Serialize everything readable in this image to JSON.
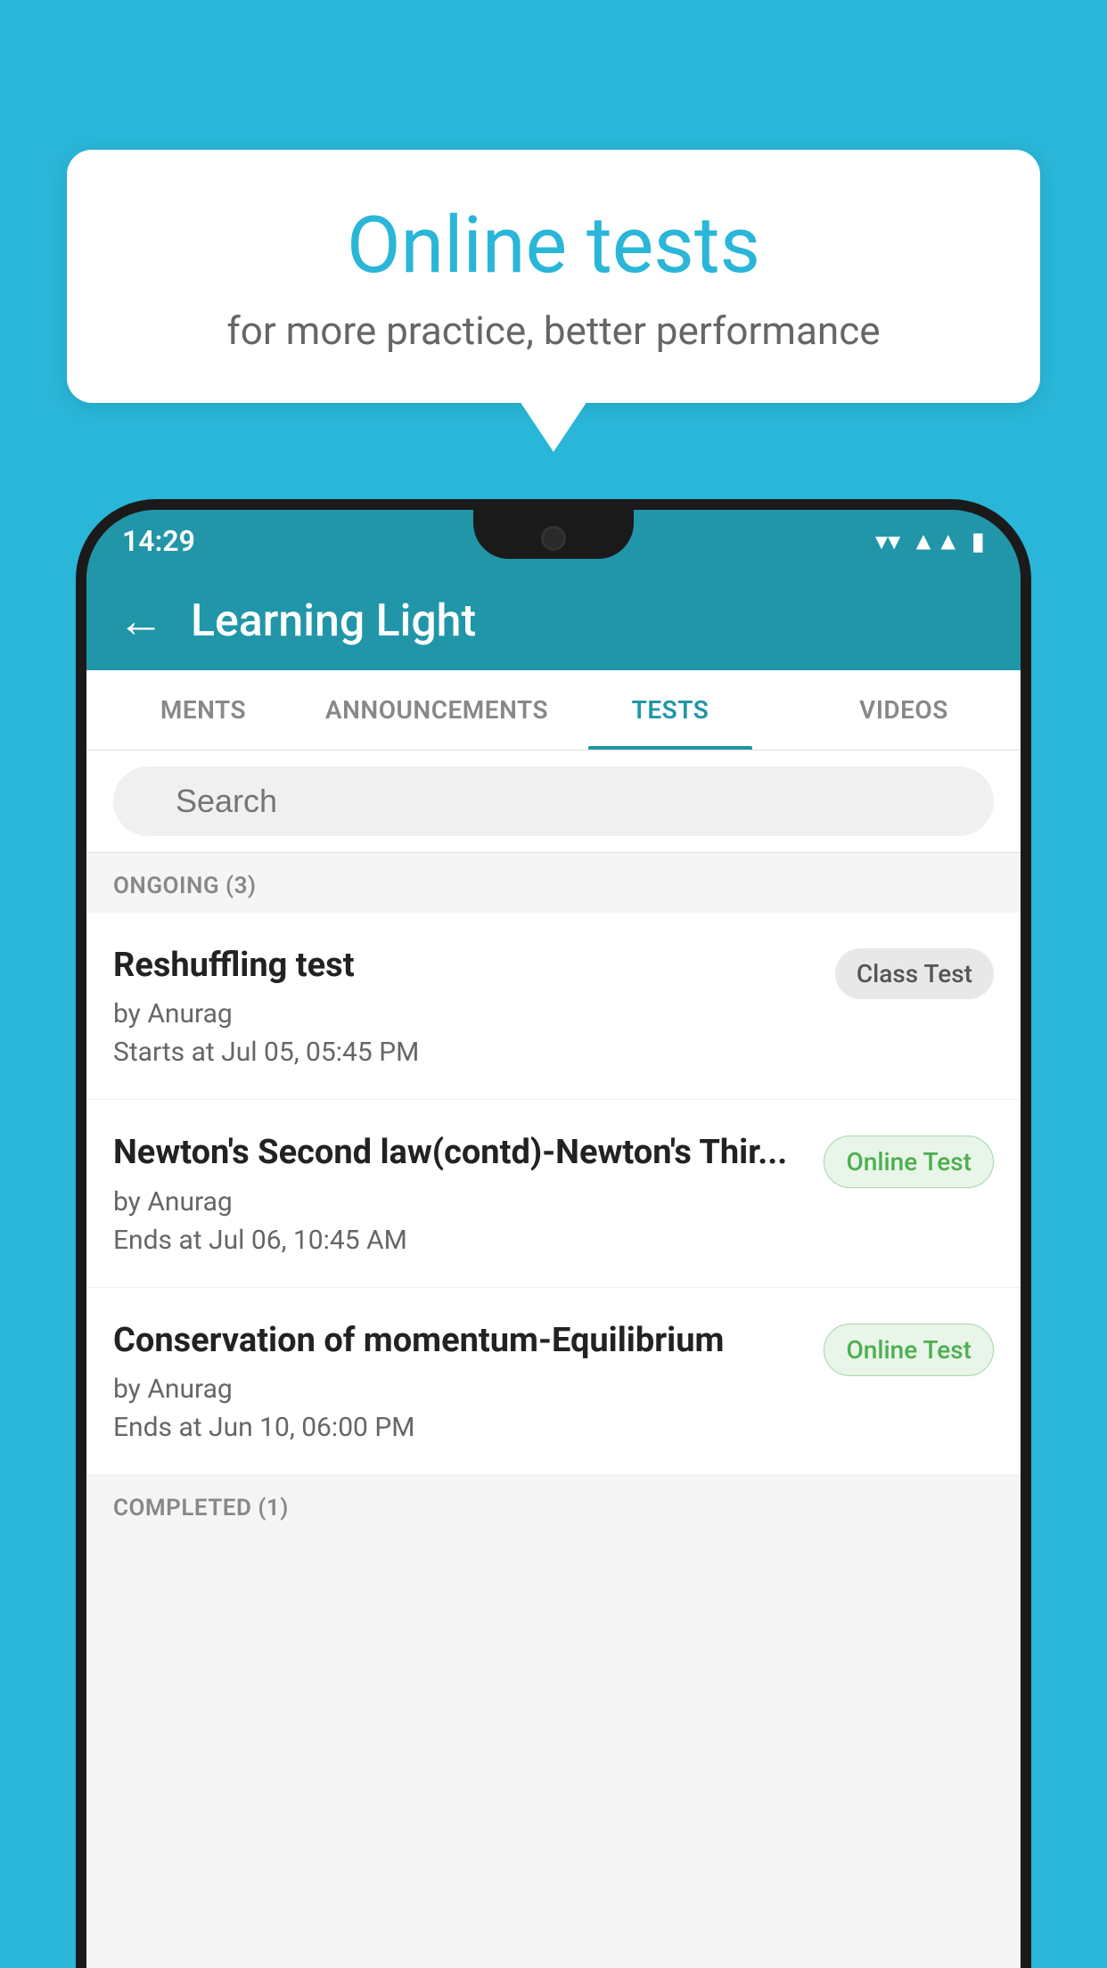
{
  "background_color": "#29b6d8",
  "speech_bubble": {
    "title": "Online tests",
    "subtitle": "for more practice, better performance"
  },
  "status_bar": {
    "time": "14:29",
    "icons": [
      "wifi",
      "signal",
      "battery"
    ]
  },
  "app_header": {
    "title": "Learning Light",
    "back_label": "←"
  },
  "tabs": [
    {
      "label": "MENTS",
      "active": false
    },
    {
      "label": "ANNOUNCEMENTS",
      "active": false
    },
    {
      "label": "TESTS",
      "active": true
    },
    {
      "label": "VIDEOS",
      "active": false
    }
  ],
  "search": {
    "placeholder": "Search"
  },
  "sections": [
    {
      "title": "ONGOING (3)",
      "items": [
        {
          "name": "Reshuffling test",
          "by": "by Anurag",
          "time": "Starts at  Jul 05, 05:45 PM",
          "badge": "Class Test",
          "badge_type": "class"
        },
        {
          "name": "Newton's Second law(contd)-Newton's Thir...",
          "by": "by Anurag",
          "time": "Ends at  Jul 06, 10:45 AM",
          "badge": "Online Test",
          "badge_type": "online"
        },
        {
          "name": "Conservation of momentum-Equilibrium",
          "by": "by Anurag",
          "time": "Ends at  Jun 10, 06:00 PM",
          "badge": "Online Test",
          "badge_type": "online"
        }
      ]
    },
    {
      "title": "COMPLETED (1)",
      "items": []
    }
  ]
}
